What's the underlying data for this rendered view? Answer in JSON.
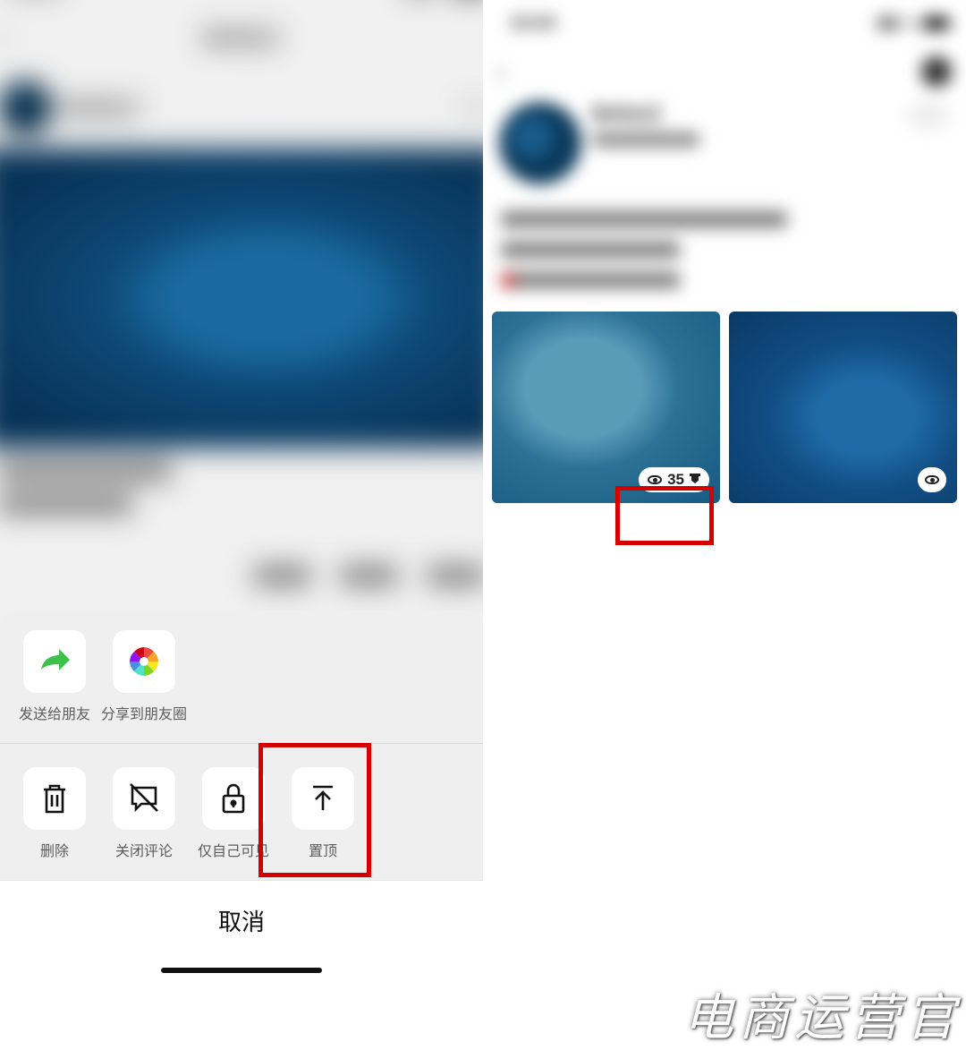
{
  "status": {
    "time": "10:04"
  },
  "left": {
    "nav_title": "Bella12",
    "username": "Bella12"
  },
  "sheet": {
    "row1": [
      {
        "id": "send-friend",
        "label": "发送给朋友"
      },
      {
        "id": "share-moments",
        "label": "分享到朋友圈"
      }
    ],
    "row2": [
      {
        "id": "delete",
        "label": "删除"
      },
      {
        "id": "close-comment",
        "label": "关闭评论"
      },
      {
        "id": "self-only",
        "label": "仅自己可见"
      },
      {
        "id": "pin-top",
        "label": "置顶"
      }
    ],
    "cancel": "取消"
  },
  "right": {
    "username": "Bella12",
    "view_count": "35"
  },
  "watermark": "电商运营官"
}
